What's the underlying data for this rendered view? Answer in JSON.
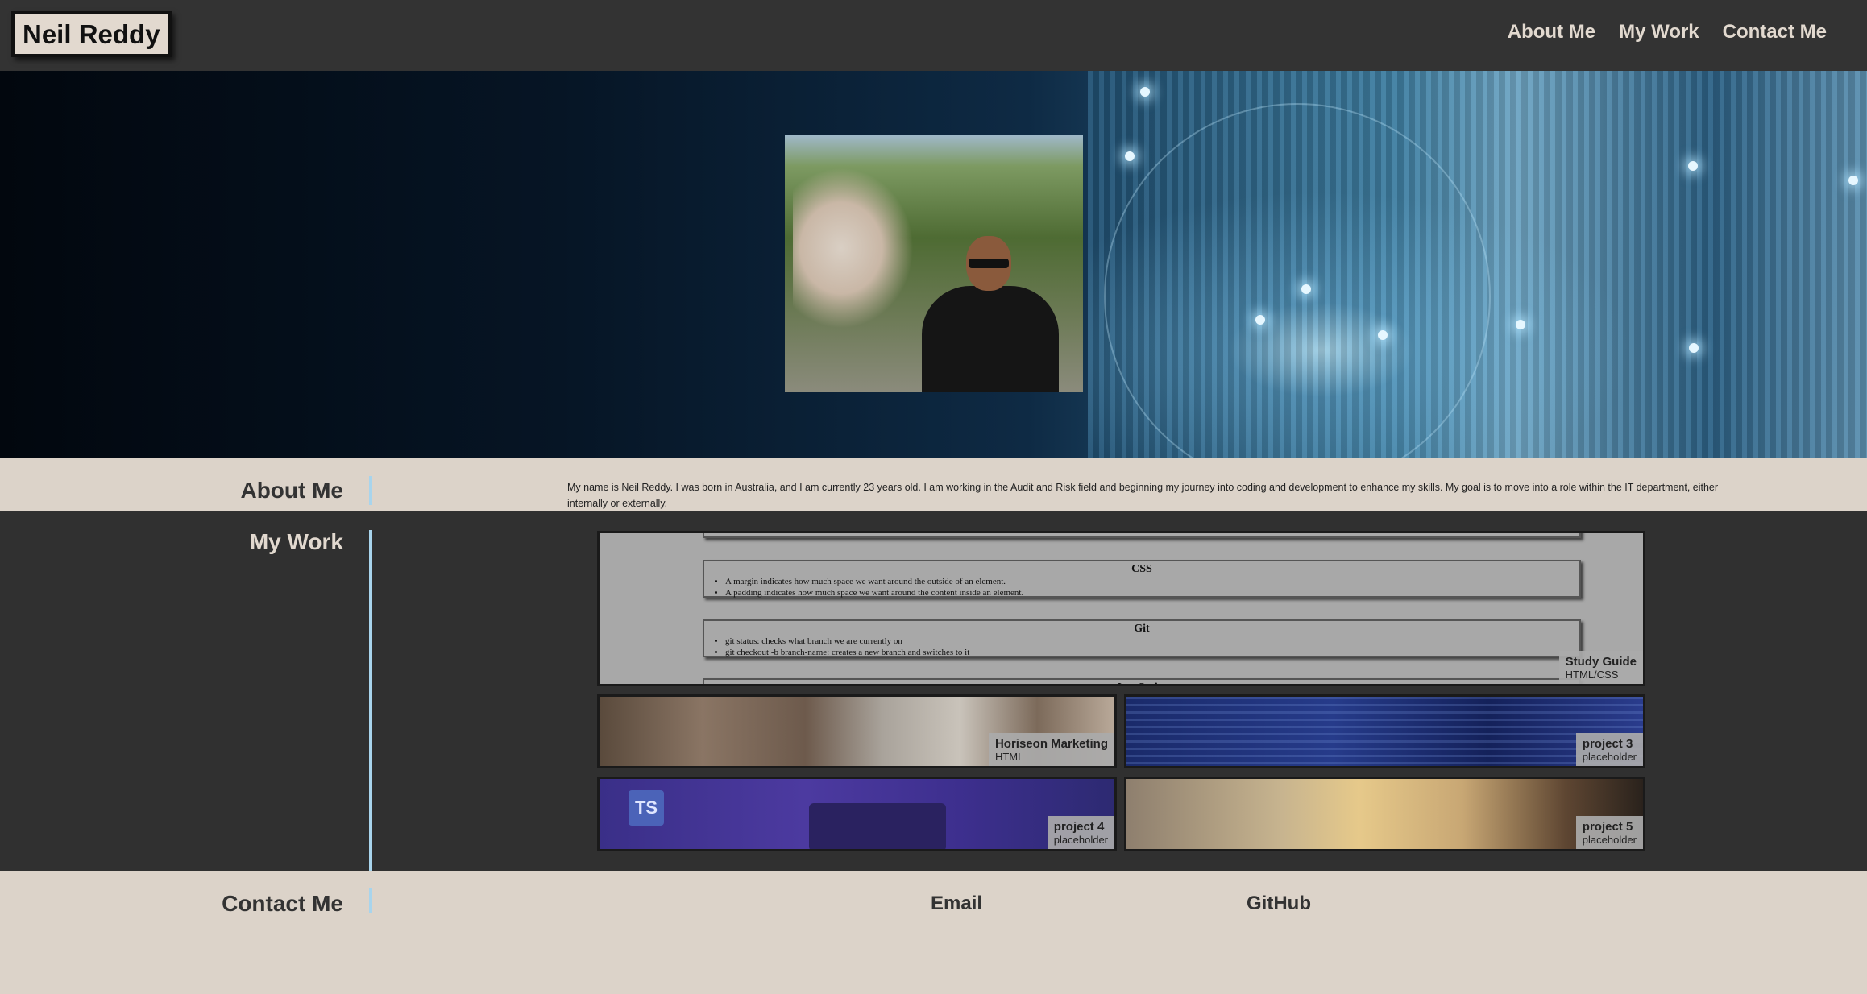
{
  "header": {
    "logo": "Neil Reddy",
    "nav": [
      "About Me",
      "My Work",
      "Contact Me"
    ]
  },
  "about": {
    "title": "About Me",
    "text": "My name is Neil Reddy. I was born in Australia, and I am currently 23 years old. I am working in the Audit and Risk field and beginning my journey into coding and development to enhance my skills. My goal is to move into a role within the IT department, either internally or externally."
  },
  "work": {
    "title": "My Work",
    "study_guide": {
      "sections": [
        {
          "heading": "CSS",
          "items": [
            "A margin indicates how much space we want around the outside of an element.",
            "A padding indicates how much space we want around the content inside an element."
          ]
        },
        {
          "heading": "Git",
          "items": [
            "git status: checks what branch we are currently on",
            "git checkout -b branch-name: creates a new branch and switches to it"
          ]
        },
        {
          "heading": "JavaScript",
          "items": []
        }
      ],
      "title": "Study Guide",
      "subtitle": "HTML/CSS"
    },
    "projects": [
      {
        "title": "Horiseon Marketing",
        "subtitle": "HTML"
      },
      {
        "title": "project 3",
        "subtitle": "placeholder"
      },
      {
        "title": "project 4",
        "subtitle": "placeholder",
        "badge": "TS"
      },
      {
        "title": "project 5",
        "subtitle": "placeholder"
      }
    ]
  },
  "contact": {
    "title": "Contact Me",
    "links": [
      "Email",
      "GitHub"
    ]
  },
  "colors": {
    "header_bg": "#333333",
    "band_bg": "#dcd3c9",
    "accent_rule": "#a8d4ec"
  }
}
